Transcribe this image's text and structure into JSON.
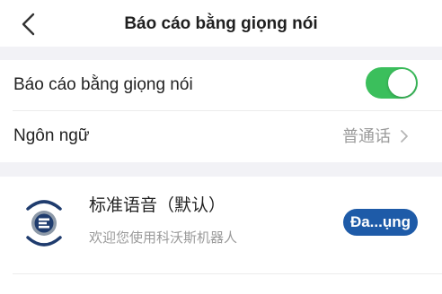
{
  "header": {
    "title": "Báo cáo bằng giọng nói",
    "back_icon": "chevron-left-icon"
  },
  "settings": {
    "voice_report": {
      "label": "Báo cáo bằng giọng nói",
      "enabled": true,
      "toggle_color": "#3bbf5c"
    },
    "language": {
      "label": "Ngôn ngữ",
      "value": "普通话",
      "icon": "chevron-right-icon"
    }
  },
  "voice_pack": {
    "name": "标准语音（默认）",
    "description": "欢迎您使用科沃斯机器人",
    "status_label": "Đa...ụng",
    "status_color": "#1e5ba8",
    "logo_icon": "voice-pack-logo-icon"
  },
  "colors": {
    "section_background": "#f2f2f6",
    "secondary_text": "#9a9a9a"
  }
}
